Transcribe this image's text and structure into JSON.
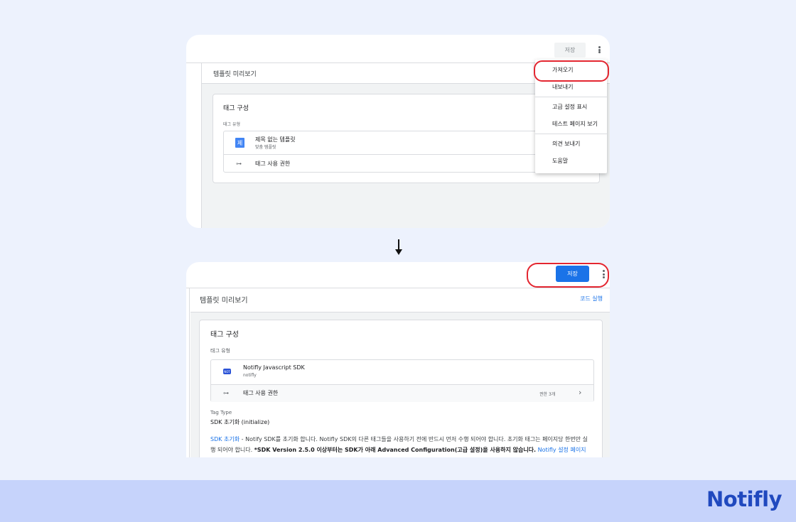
{
  "before": {
    "toolbar": {
      "save_label": "저장"
    },
    "preview_title": "템플릿 미리보기",
    "card": {
      "title": "태그 구성",
      "tag_type_label": "태그 유형",
      "tag": {
        "icon_letter": "제",
        "name": "제목 없는 템플릿",
        "subtitle": "맞춤 템플릿"
      },
      "permissions_label": "태그 사용 권한"
    },
    "menu": {
      "items": [
        "가져오기",
        "내보내기",
        "고급 설정 표시",
        "테스트 페이지 보기",
        "의견 보내기",
        "도움말"
      ],
      "highlighted": "가져오기"
    }
  },
  "after": {
    "toolbar": {
      "save_label": "저장"
    },
    "preview_title": "템플릿 미리보기",
    "run_code_label": "코드 실행",
    "card": {
      "title": "태그 구성",
      "tag_type_label": "태그 유형",
      "tag": {
        "icon_text": "NOT",
        "name": "Notifly Javascript SDK",
        "subtitle": "notifly"
      },
      "permissions_label": "태그 사용 권한",
      "permissions_count": "권한 3개",
      "tag_type_field_label": "Tag Type",
      "tag_type_field_value": "SDK 초기화 (initialize)",
      "description": {
        "link1": "SDK 초기화",
        "text1": " - Notify SDK를 초기화 합니다. Notifly SDK의 다른 태그들을 사용하기 전에 반드시 먼저 수행 되어야 합니다. 초기화 태그는 페이지당 한번만 실행 되어야 합니다. ",
        "bold": "*SDK Version 2.5.0 이상부터는 SDK가 아래 Advanced Configuration(고급 설정)을 사용하지 않습니다.",
        "link2": " Notifly 설정 페이지"
      }
    }
  },
  "brand": {
    "logo_text": "Notifly",
    "logo_color": "#2049bf",
    "accent": "#1a73e8",
    "highlight": "#e32630"
  }
}
